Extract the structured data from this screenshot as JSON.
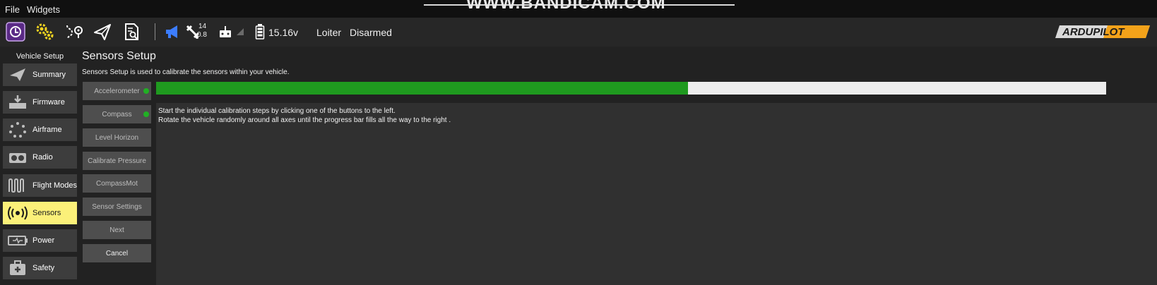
{
  "menubar": {
    "items": [
      "File",
      "Widgets"
    ],
    "watermark": "WWW.BANDICAM.COM"
  },
  "toolbar": {
    "icons": [
      "app-logo-icon",
      "settings-gears-icon",
      "plan-route-icon",
      "fly-paper-plane-icon",
      "analyze-document-icon"
    ],
    "gps_count": "14",
    "gps_hdop": "0.8",
    "battery_voltage": "15.16v",
    "flight_mode": "Loiter",
    "arm_status": "Disarmed",
    "brand": "ARDUPILOT"
  },
  "sidebar": {
    "title": "Vehicle Setup",
    "items": [
      {
        "label": "Summary",
        "icon": "paper-plane-icon",
        "active": false
      },
      {
        "label": "Firmware",
        "icon": "firmware-download-icon",
        "active": false
      },
      {
        "label": "Airframe",
        "icon": "airframe-dots-icon",
        "active": false
      },
      {
        "label": "Radio",
        "icon": "radio-icon",
        "active": false
      },
      {
        "label": "Flight Modes",
        "icon": "flight-modes-wave-icon",
        "active": false
      },
      {
        "label": "Sensors",
        "icon": "sensors-radar-icon",
        "active": true
      },
      {
        "label": "Power",
        "icon": "power-battery-icon",
        "active": false
      },
      {
        "label": "Safety",
        "icon": "safety-plus-icon",
        "active": false
      }
    ]
  },
  "main": {
    "title": "Sensors Setup",
    "description": "Sensors Setup is used to calibrate the sensors within your vehicle.",
    "buttons": [
      {
        "label": "Accelerometer",
        "calibrated": true
      },
      {
        "label": "Compass",
        "calibrated": true
      },
      {
        "label": "Level Horizon",
        "calibrated": false
      },
      {
        "label": "Calibrate Pressure",
        "calibrated": false
      },
      {
        "label": "CompassMot",
        "calibrated": false
      },
      {
        "label": "Sensor Settings",
        "calibrated": false
      },
      {
        "label": "Next",
        "calibrated": false
      },
      {
        "label": "Cancel",
        "calibrated": false
      }
    ],
    "progress": 0.56,
    "instructions": [
      "Start the individual calibration steps by clicking one of the buttons to the left.",
      "Rotate the vehicle randomly around all axes until the progress bar fills all the way to the right ."
    ]
  },
  "colors": {
    "accent_yellow": "#fbf079",
    "progress_green": "#1f9a1f",
    "status_green": "#21b024",
    "vehicle_icon_blue": "#3c7dff"
  }
}
